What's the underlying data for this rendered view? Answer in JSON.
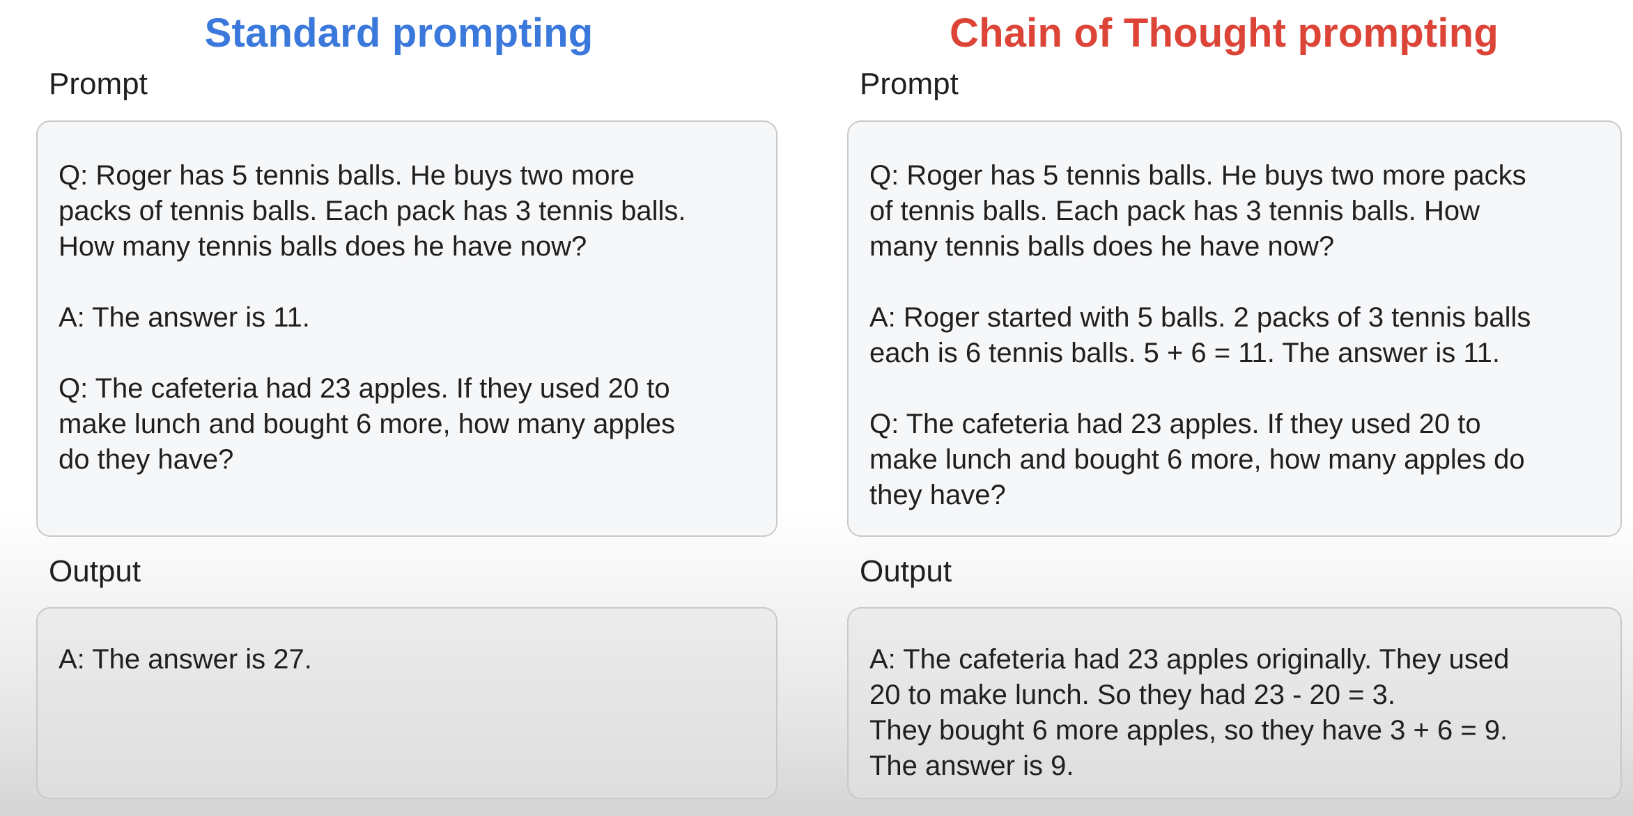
{
  "standard": {
    "title": "Standard prompting",
    "prompt_label": "Prompt",
    "prompt_paragraphs": [
      "Q: Roger has 5 tennis balls. He buys two more\npacks of tennis balls. Each pack has 3 tennis balls.\nHow many tennis balls does he have now?",
      "A: The answer is 11.",
      "Q: The cafeteria had 23 apples. If they used 20 to\nmake lunch and bought 6 more, how many apples\ndo they have?"
    ],
    "output_label": "Output",
    "output_text": "A: The answer is 27."
  },
  "cot": {
    "title": "Chain of Thought prompting",
    "prompt_label": "Prompt",
    "prompt_paragraphs": [
      "Q: Roger has 5 tennis balls. He buys two more packs\nof tennis balls. Each pack has 3 tennis balls. How\nmany tennis balls does he have now?",
      "A: Roger started with 5 balls. 2 packs of 3 tennis balls\neach is 6 tennis balls. 5 + 6 = 11. The answer is 11.",
      "Q: The cafeteria had 23 apples. If they used 20 to\nmake lunch and bought 6 more, how many apples do\nthey have?"
    ],
    "output_label": "Output",
    "output_text": "A: The cafeteria had 23 apples originally. They used\n20 to make lunch. So they had 23 - 20 = 3.\nThey bought 6 more apples, so they have 3 + 6 = 9.\nThe answer is 9."
  },
  "colors": {
    "standard_title": "#3b78dc",
    "cot_title": "#dc4437"
  }
}
